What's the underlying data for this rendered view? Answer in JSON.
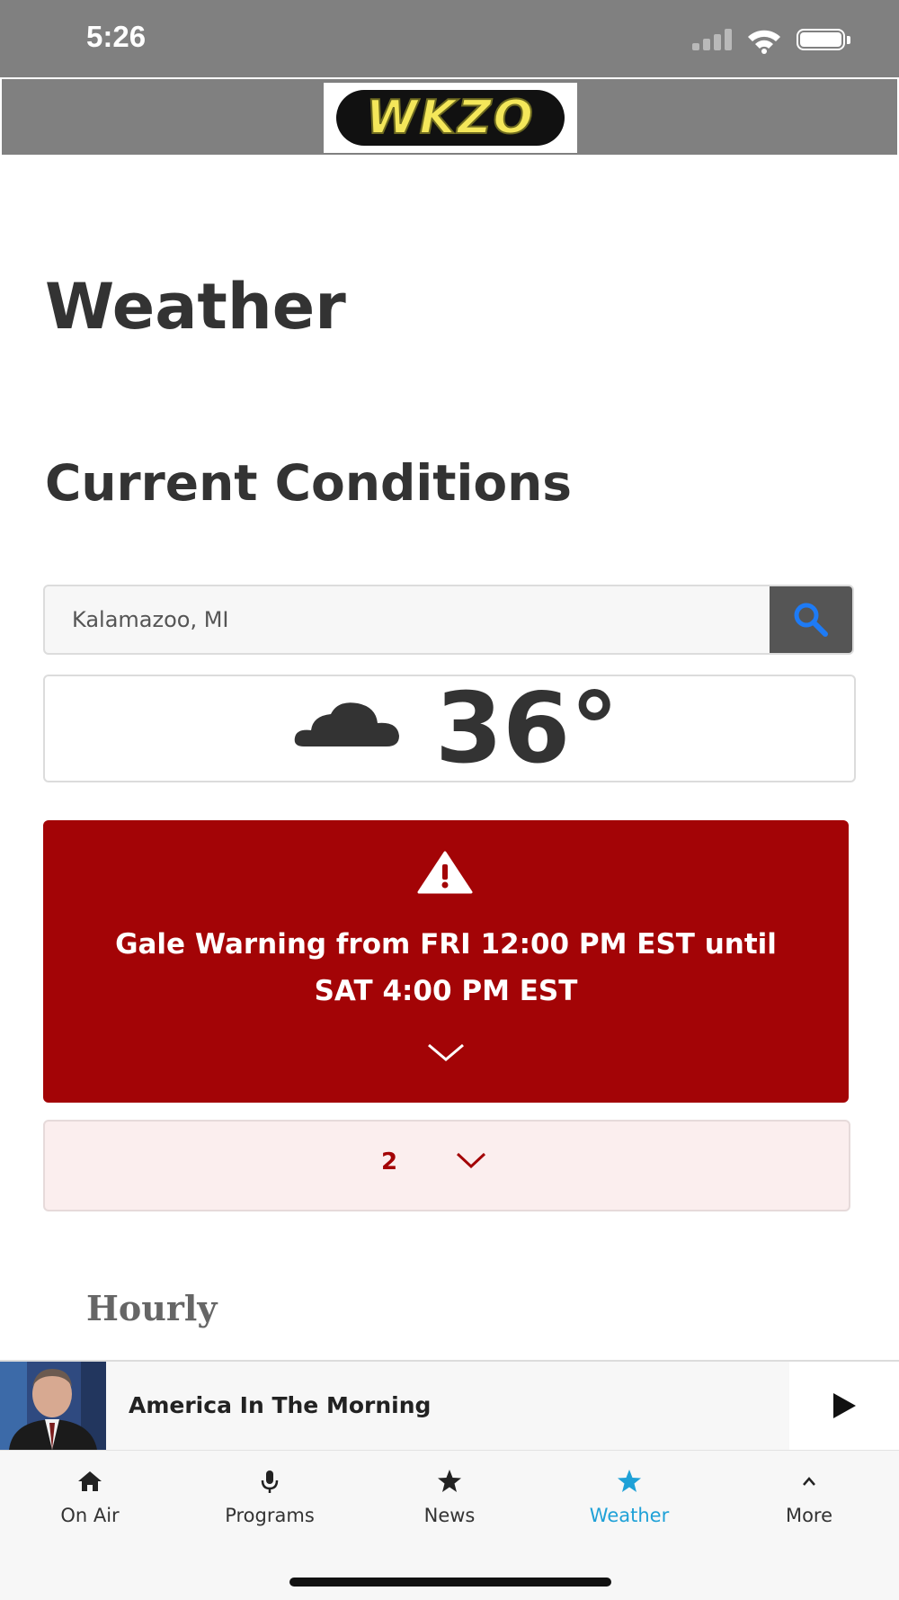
{
  "status_bar": {
    "time": "5:26"
  },
  "header": {
    "logo_text": "WKZO"
  },
  "page": {
    "title": "Weather",
    "section_title": "Current Conditions"
  },
  "search": {
    "value": "Kalamazoo, MI",
    "placeholder": "Kalamazoo, MI",
    "icon": "search-icon"
  },
  "current": {
    "condition_icon": "cloud-icon",
    "temperature": "36°"
  },
  "alert": {
    "icon": "warning-icon",
    "text": "Gale Warning from FRI 12:00 PM EST until SAT 4:00 PM EST",
    "color": "#a30406"
  },
  "more_alerts": {
    "count": "2"
  },
  "hourly": {
    "title": "Hourly"
  },
  "player": {
    "title": "America In The Morning",
    "play_icon": "play-icon"
  },
  "tabs": [
    {
      "label": "On Air",
      "icon": "home-icon",
      "active": false
    },
    {
      "label": "Programs",
      "icon": "microphone-icon",
      "active": false
    },
    {
      "label": "News",
      "icon": "star-icon",
      "active": false
    },
    {
      "label": "Weather",
      "icon": "star-icon",
      "active": true
    },
    {
      "label": "More",
      "icon": "chevron-up-icon",
      "active": false
    }
  ],
  "colors": {
    "header_gray": "#808080",
    "alert_red": "#a30406",
    "active_tab": "#1fa1d7",
    "search_icon_blue": "#1e7bf5"
  }
}
